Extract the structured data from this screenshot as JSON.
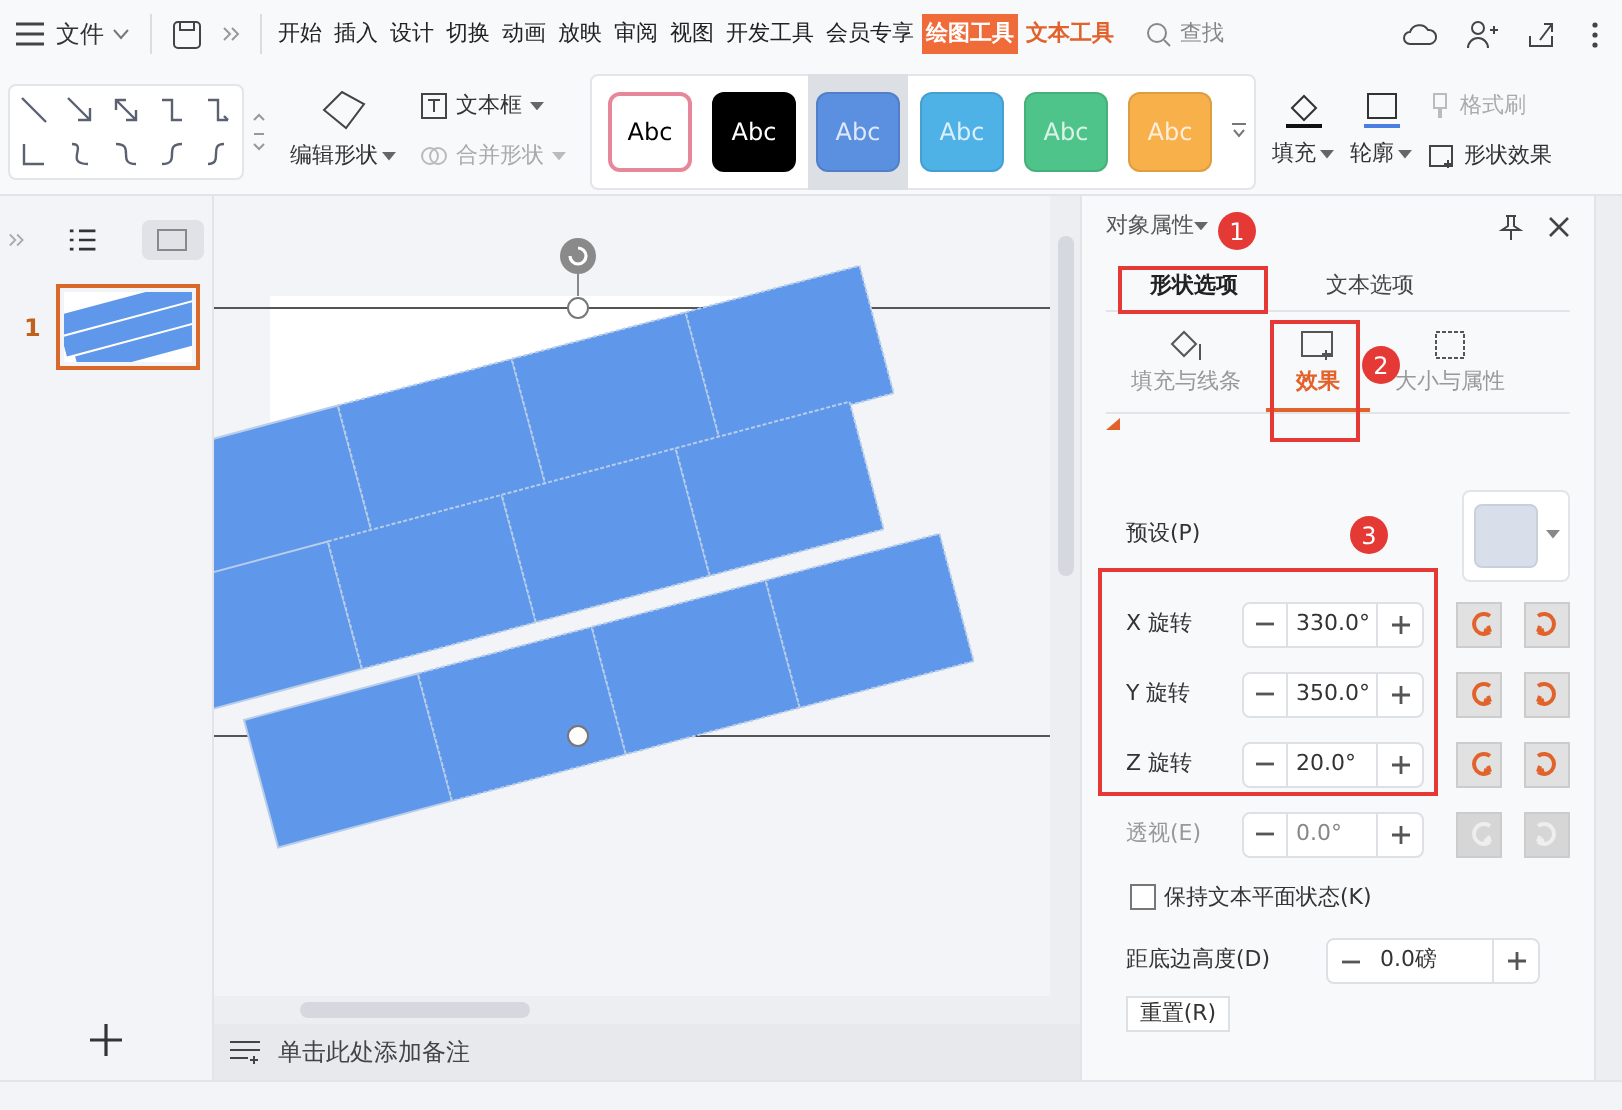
{
  "menu": {
    "file_label": "文件",
    "tabs": [
      {
        "label": "开始",
        "kind": "normal",
        "selected": false
      },
      {
        "label": "插入",
        "kind": "normal",
        "selected": false
      },
      {
        "label": "设计",
        "kind": "normal",
        "selected": false
      },
      {
        "label": "切换",
        "kind": "normal",
        "selected": false
      },
      {
        "label": "动画",
        "kind": "normal",
        "selected": false
      },
      {
        "label": "放映",
        "kind": "normal",
        "selected": false
      },
      {
        "label": "审阅",
        "kind": "normal",
        "selected": false
      },
      {
        "label": "视图",
        "kind": "normal",
        "selected": false
      },
      {
        "label": "开发工具",
        "kind": "normal",
        "selected": false
      },
      {
        "label": "会员专享",
        "kind": "normal",
        "selected": false
      },
      {
        "label": "绘图工具",
        "kind": "contextual",
        "selected": true
      },
      {
        "label": "文本工具",
        "kind": "contextual",
        "selected": false
      }
    ],
    "search_placeholder": "查找"
  },
  "ribbon": {
    "edit_shape": "编辑形状",
    "textbox": "文本框",
    "merge_shapes": {
      "label": "合并形状",
      "disabled": true
    },
    "styles": [
      {
        "label": "Abc",
        "color": "#ffffff",
        "selected": false
      },
      {
        "label": "Abc",
        "color": "#000000",
        "selected": false
      },
      {
        "label": "Abc",
        "color": "#5b8fe0",
        "selected": true
      },
      {
        "label": "Abc",
        "color": "#4fb2e6",
        "selected": false
      },
      {
        "label": "Abc",
        "color": "#4fc48a",
        "selected": false
      },
      {
        "label": "Abc",
        "color": "#f7b04a",
        "selected": false
      }
    ],
    "fill": "填充",
    "outline": "轮廓",
    "format_painter": {
      "label": "格式刷",
      "disabled": true
    },
    "shape_effects": "形状效果"
  },
  "slides": [
    {
      "number": "1",
      "selected": true
    }
  ],
  "notes_placeholder": "单击此处添加备注",
  "panel": {
    "title": "对象属性",
    "tabs": [
      {
        "label": "形状选项",
        "selected": true
      },
      {
        "label": "文本选项",
        "selected": false
      }
    ],
    "subtabs": [
      {
        "label": "填充与线条",
        "selected": false
      },
      {
        "label": "效果",
        "selected": true
      },
      {
        "label": "大小与属性",
        "selected": false
      }
    ],
    "preset_label": "预设(P)",
    "rotations": [
      {
        "label": "X 旋转",
        "value": "330.0°",
        "disabled": false
      },
      {
        "label": "Y 旋转",
        "value": "350.0°",
        "disabled": false
      },
      {
        "label": "Z 旋转",
        "value": "20.0°",
        "disabled": false
      },
      {
        "label": "透视(E)",
        "value": "0.0°",
        "disabled": true
      }
    ],
    "keep_flat": {
      "label": "保持文本平面状态(K)",
      "checked": false
    },
    "distance": {
      "label": "距底边高度(D)",
      "value": "0.0磅"
    },
    "reset": "重置(R)"
  },
  "annotations": [
    "1",
    "2",
    "3"
  ]
}
